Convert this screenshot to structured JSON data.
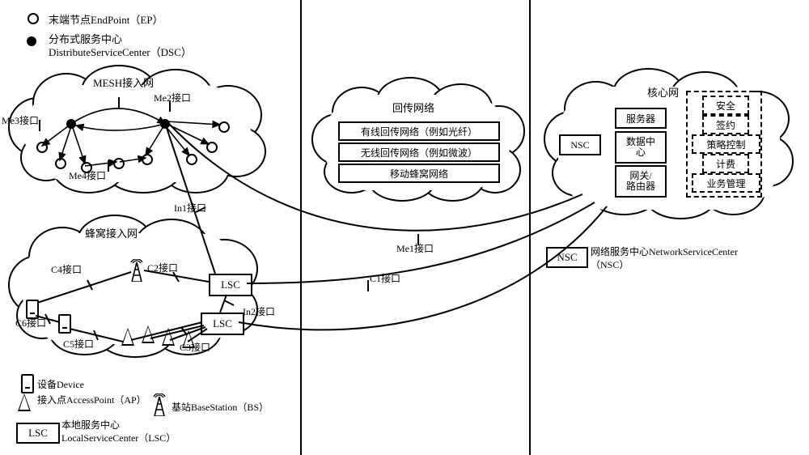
{
  "legend": {
    "ep": "末端节点EndPoint（EP）",
    "dsc_line1": "分布式服务中心",
    "dsc_line2": "DistributeServiceCenter（DSC）",
    "device": "设备Device",
    "ap": "接入点AccessPoint（AP）",
    "bs": "基站BaseStation（BS）",
    "lsc_box": "LSC",
    "lsc_text_line1": "本地服务中心",
    "lsc_text_line2": "LocalServiceCenter（LSC）",
    "nsc_box": "NSC",
    "nsc_text_line1": "网络服务中心NetworkServiceCenter",
    "nsc_text_line2": "（NSC）"
  },
  "clouds": {
    "mesh_title": "MESH接入网",
    "cellular_title": "蜂窝接入网",
    "backhaul_title": "回传网络",
    "core_title": "核心网"
  },
  "backhaul": {
    "wired": "有线回传网络（例如光纤）",
    "wireless": "无线回传网络（例如微波）",
    "mobile": "移动蜂窝网络"
  },
  "core": {
    "server": "服务器",
    "nsc": "NSC",
    "datacenter_l1": "数据中",
    "datacenter_l2": "心",
    "gateway_l1": "网关/",
    "gateway_l2": "路由器",
    "security": "安全",
    "subscription": "签约",
    "policy": "策略控制",
    "charging": "计费",
    "service_mgmt": "业务管理"
  },
  "interfaces": {
    "me2": "Me2接口",
    "me3": "Me3接口",
    "me4": "Me4接口",
    "in1": "In1接口",
    "in2": "In2接口",
    "me1": "Me1接口",
    "c1": "C1接口",
    "c2": "C2接口",
    "c3": "C3接口",
    "c4": "C4接口",
    "c5": "C5接口",
    "c6": "C6接口"
  },
  "boxes": {
    "lsc1": "LSC",
    "lsc2": "LSC"
  }
}
